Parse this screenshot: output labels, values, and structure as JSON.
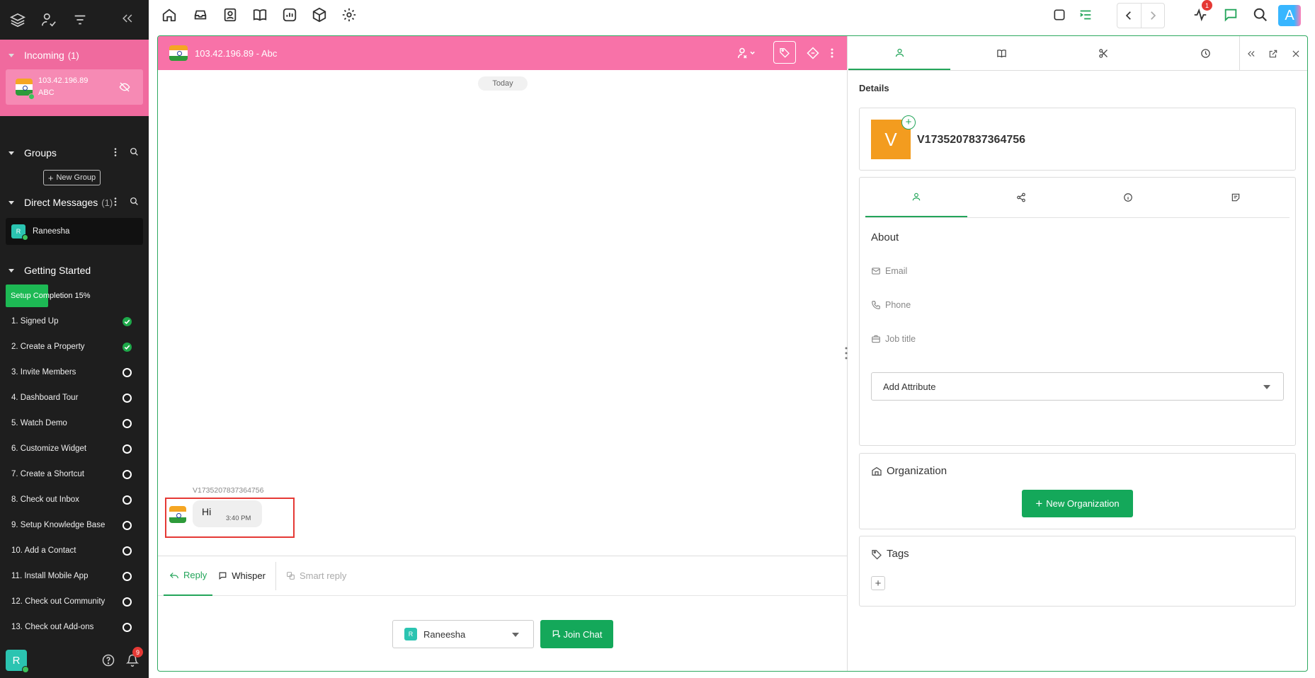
{
  "sidebar": {
    "incoming": {
      "label": "Incoming",
      "count": "(1)",
      "ip": "103.42.196.89",
      "name": "ABC"
    },
    "groups": {
      "label": "Groups",
      "new_group": "New Group"
    },
    "dm": {
      "label": "Direct Messages",
      "count": "(1)",
      "user": "Raneesha",
      "avatar": "R"
    },
    "getting_started": {
      "label": "Getting Started",
      "setup": "Setup Completion 15%",
      "setup_percent": 15
    },
    "steps": [
      {
        "label": "1. Signed Up",
        "done": true
      },
      {
        "label": "2. Create a Property",
        "done": true
      },
      {
        "label": "3. Invite Members",
        "done": false
      },
      {
        "label": "4. Dashboard Tour",
        "done": false
      },
      {
        "label": "5. Watch Demo",
        "done": false
      },
      {
        "label": "6. Customize Widget",
        "done": false
      },
      {
        "label": "7. Create a Shortcut",
        "done": false
      },
      {
        "label": "8. Check out Inbox",
        "done": false
      },
      {
        "label": "9. Setup Knowledge Base",
        "done": false
      },
      {
        "label": "10. Add a Contact",
        "done": false
      },
      {
        "label": "11. Install Mobile App",
        "done": false
      },
      {
        "label": "12. Check out Community",
        "done": false
      },
      {
        "label": "13. Check out Add-ons",
        "done": false
      }
    ],
    "bottom": {
      "avatar": "R",
      "notifications": "9"
    }
  },
  "topbar": {
    "activity_badge": "1",
    "user_avatar": "A"
  },
  "chat": {
    "title": "103.42.196.89 - Abc",
    "date_divider": "Today",
    "message": {
      "sender": "V1735207837364756",
      "text": "Hi",
      "time": "3:40 PM"
    },
    "composer": {
      "reply": "Reply",
      "whisper": "Whisper",
      "smart_reply": "Smart reply",
      "agent": "Raneesha",
      "agent_avatar": "R",
      "join": "Join Chat"
    }
  },
  "details": {
    "heading": "Details",
    "visitor": {
      "initial": "V",
      "name": "V1735207837364756"
    },
    "about": "About",
    "email": "Email",
    "phone": "Phone",
    "job_title": "Job title",
    "add_attribute": "Add Attribute",
    "organization": "Organization",
    "new_org": "New Organization",
    "tags": "Tags"
  },
  "colors": {
    "accent": "#14a85a",
    "incoming_bg": "#f06a9e",
    "chat_header": "#f872a8",
    "visitor_avatar": "#f39c1f"
  }
}
